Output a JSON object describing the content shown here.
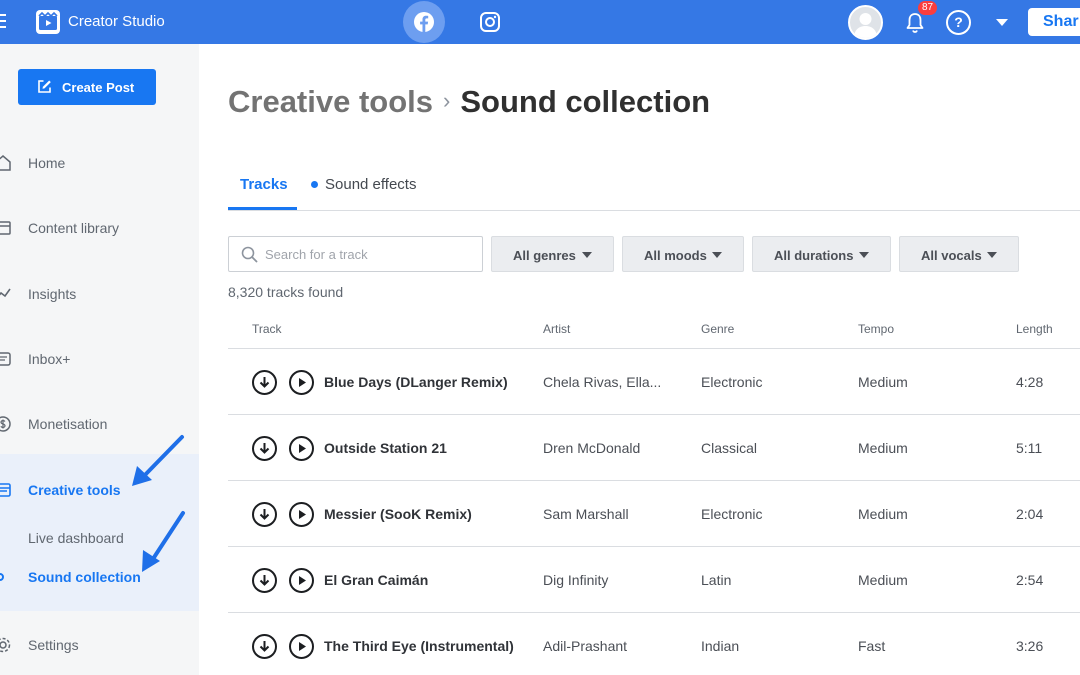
{
  "app": {
    "title": "Creator Studio",
    "share_label": "Shar",
    "notification_count": "87",
    "help_symbol": "?",
    "colors": {
      "topbar": "#3578e5",
      "accent": "#1877f2",
      "badge": "#fa3e3e"
    }
  },
  "header_icons": [
    "menu-icon",
    "creator-studio-logo-icon",
    "facebook-icon",
    "instagram-icon",
    "bell-icon",
    "help-icon",
    "chevron-down-icon"
  ],
  "sidebar": {
    "create_post_label": "Create Post",
    "items": [
      {
        "label": "Home",
        "icon": "home-icon"
      },
      {
        "label": "Content library",
        "icon": "content-library-icon"
      },
      {
        "label": "Insights",
        "icon": "insights-icon"
      },
      {
        "label": "Inbox+",
        "icon": "inbox-icon"
      },
      {
        "label": "Monetisation",
        "icon": "monetisation-icon"
      },
      {
        "label": "Creative tools",
        "icon": "creative-tools-icon",
        "active": true
      },
      {
        "label": "Settings",
        "icon": "settings-icon"
      }
    ],
    "sub_items": [
      {
        "label": "Live dashboard"
      },
      {
        "label": "Sound collection",
        "active": true
      }
    ]
  },
  "breadcrumb": {
    "parent": "Creative tools",
    "separator": "›",
    "current": "Sound collection"
  },
  "tabs": [
    {
      "label": "Tracks",
      "active": true
    },
    {
      "label": "Sound effects",
      "active": false
    }
  ],
  "search": {
    "placeholder": "Search for a track",
    "value": ""
  },
  "filters": [
    {
      "label": "All genres"
    },
    {
      "label": "All moods"
    },
    {
      "label": "All durations"
    },
    {
      "label": "All vocals"
    }
  ],
  "results_count": "8,320 tracks found",
  "table": {
    "columns": [
      "Track",
      "Artist",
      "Genre",
      "Tempo",
      "Length"
    ],
    "rows": [
      {
        "track": "Blue Days (DLanger Remix)",
        "artist": "Chela Rivas, Ella...",
        "genre": "Electronic",
        "tempo": "Medium",
        "length": "4:28"
      },
      {
        "track": "Outside Station 21",
        "artist": "Dren McDonald",
        "genre": "Classical",
        "tempo": "Medium",
        "length": "5:11"
      },
      {
        "track": "Messier (SooK Remix)",
        "artist": "Sam Marshall",
        "genre": "Electronic",
        "tempo": "Medium",
        "length": "2:04"
      },
      {
        "track": "El Gran Caimán",
        "artist": "Dig Infinity",
        "genre": "Latin",
        "tempo": "Medium",
        "length": "2:54"
      },
      {
        "track": "The Third Eye (Instrumental)",
        "artist": "Adil-Prashant",
        "genre": "Indian",
        "tempo": "Fast",
        "length": "3:26"
      }
    ]
  }
}
